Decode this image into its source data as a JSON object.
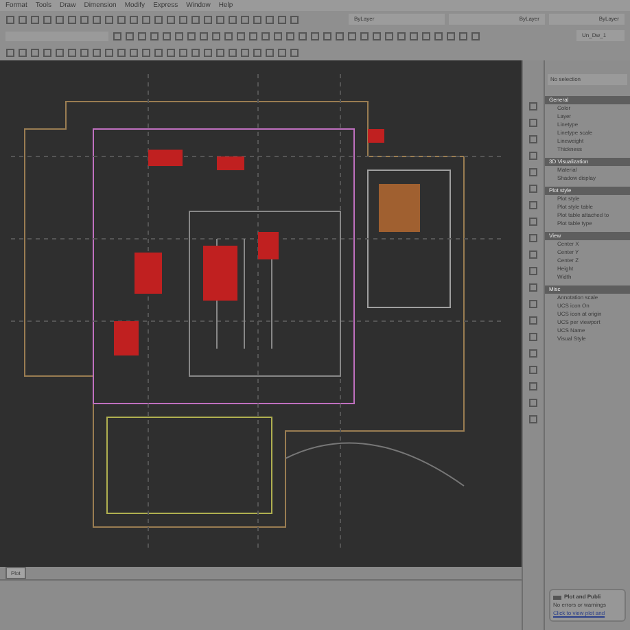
{
  "menu_bar": [
    "Format",
    "Tools",
    "Draw",
    "Dimension",
    "Modify",
    "Express",
    "Window",
    "Help"
  ],
  "toolbar": {
    "layer_dropdown": "ByLayer",
    "linetype_dropdown": "ByLayer",
    "lineweight_dropdown": "ByLayer",
    "style_dropdown": "Un_Dw_1"
  },
  "layout_tabs": [
    {
      "label": "Plot",
      "selected": true
    }
  ],
  "properties_palette": {
    "selection": "No selection",
    "sections": [
      {
        "title": "General",
        "rows": [
          "Color",
          "Layer",
          "Linetype",
          "Linetype scale",
          "Lineweight",
          "Thickness"
        ]
      },
      {
        "title": "3D Visualization",
        "rows": [
          "Material",
          "Shadow display"
        ]
      },
      {
        "title": "Plot style",
        "rows": [
          "Plot style",
          "Plot style table",
          "Plot table attached to",
          "Plot table type"
        ]
      },
      {
        "title": "View",
        "rows": [
          "Center X",
          "Center Y",
          "Center Z",
          "Height",
          "Width"
        ]
      },
      {
        "title": "Misc",
        "rows": [
          "Annotation scale",
          "UCS icon On",
          "UCS icon at origin",
          "UCS per viewport",
          "UCS Name",
          "Visual Style"
        ]
      }
    ]
  },
  "notification": {
    "title": "Plot and Publi",
    "message": "No errors or warnings",
    "link": "Click to view plot and"
  }
}
